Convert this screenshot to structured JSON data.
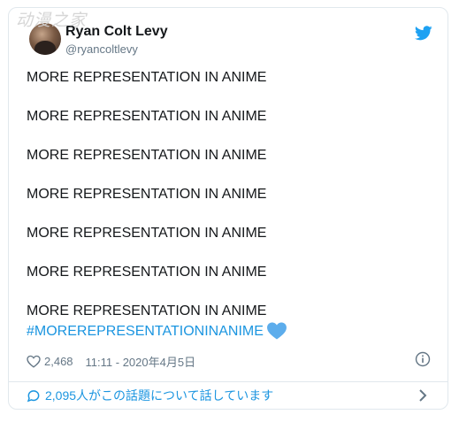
{
  "watermark": "动漫之家",
  "tweet": {
    "author_name": "Ryan Colt Levy",
    "author_handle": "@ryancoltlevy",
    "lines": [
      "MORE REPRESENTATION IN ANIME",
      "MORE REPRESENTATION IN ANIME",
      "MORE REPRESENTATION IN ANIME",
      "MORE REPRESENTATION IN ANIME",
      "MORE REPRESENTATION IN ANIME",
      "MORE REPRESENTATION IN ANIME",
      "MORE REPRESENTATION IN ANIME"
    ],
    "hashtag": "#MOREREPRESENTATIONINANIME",
    "likes": "2,468",
    "timestamp": "11:11 - 2020年4月5日",
    "talking_about": "2,095人がこの話題について話しています"
  },
  "icons": {
    "avatar": "profile-photo",
    "brand": "twitter-bird-icon",
    "emoji": "blue-heart-emoji",
    "like": "heart-outline-icon",
    "info": "info-icon",
    "talk": "speech-bubble-icon",
    "chevron": "chevron-right-icon"
  },
  "colors": {
    "brand_blue": "#1da1f2",
    "link_blue": "#1b95e0",
    "secondary_text": "#657786",
    "border": "#e1e8ed"
  }
}
